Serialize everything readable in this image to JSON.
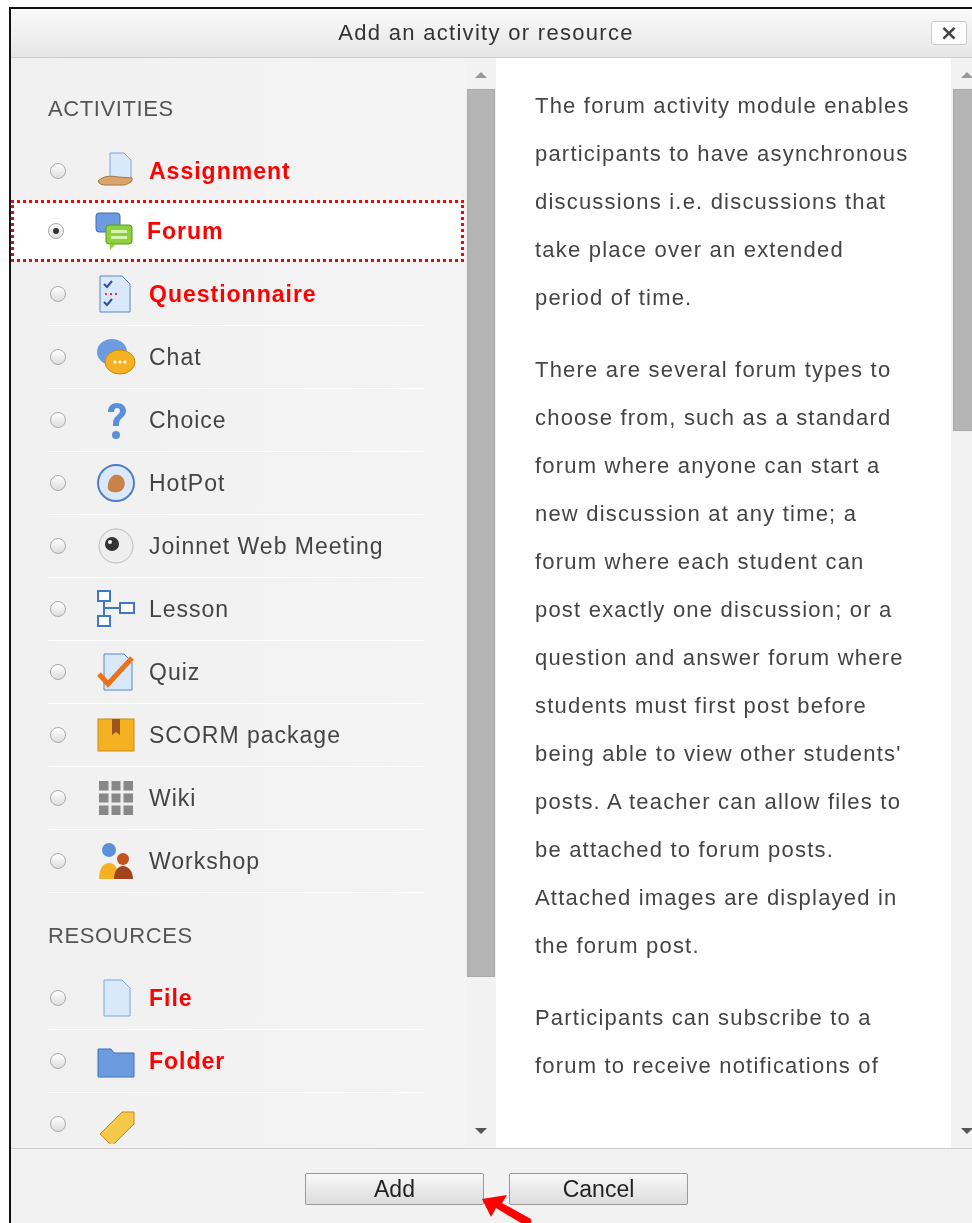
{
  "dialog": {
    "title": "Add an activity or resource",
    "close": "×"
  },
  "sections": [
    {
      "heading": "ACTIVITIES",
      "items": [
        {
          "kind": "assignment",
          "label": "Assignment",
          "highlighted": true,
          "selected": false
        },
        {
          "kind": "forum",
          "label": "Forum",
          "highlighted": true,
          "selected": true
        },
        {
          "kind": "questionnaire",
          "label": "Questionnaire",
          "highlighted": true,
          "selected": false
        },
        {
          "kind": "chat",
          "label": "Chat",
          "highlighted": false,
          "selected": false
        },
        {
          "kind": "choice",
          "label": "Choice",
          "highlighted": false,
          "selected": false
        },
        {
          "kind": "hotpot",
          "label": "HotPot",
          "highlighted": false,
          "selected": false
        },
        {
          "kind": "joinnet",
          "label": "Joinnet Web Meeting",
          "highlighted": false,
          "selected": false
        },
        {
          "kind": "lesson",
          "label": "Lesson",
          "highlighted": false,
          "selected": false
        },
        {
          "kind": "quiz",
          "label": "Quiz",
          "highlighted": false,
          "selected": false
        },
        {
          "kind": "scorm",
          "label": "SCORM package",
          "highlighted": false,
          "selected": false
        },
        {
          "kind": "wiki",
          "label": "Wiki",
          "highlighted": false,
          "selected": false
        },
        {
          "kind": "workshop",
          "label": "Workshop",
          "highlighted": false,
          "selected": false
        }
      ]
    },
    {
      "heading": "RESOURCES",
      "items": [
        {
          "kind": "file",
          "label": "File",
          "highlighted": true,
          "selected": false
        },
        {
          "kind": "folder",
          "label": "Folder",
          "highlighted": true,
          "selected": false
        },
        {
          "kind": "tag",
          "selected": false
        }
      ]
    }
  ],
  "description": [
    "The forum activity module enables participants to have asynchronous discussions i.e. discussions that take place over an extended period of time.",
    "There are several forum types to choose from, such as a standard forum where anyone can start a new discussion at any time; a forum where each student can post exactly one discussion; or a question and answer forum where students must first post before being able to view other students' posts. A teacher can allow files to be attached to forum posts. Attached images are displayed in the forum post.",
    "Participants can subscribe to a forum to receive notifications of"
  ],
  "buttons": [
    "Add",
    "Cancel"
  ]
}
